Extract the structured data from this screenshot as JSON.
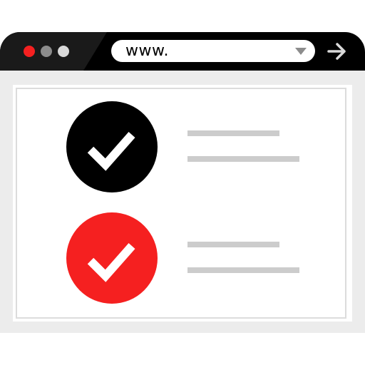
{
  "browser": {
    "url_text": "www.",
    "window_controls": [
      "close",
      "minimize",
      "maximize"
    ],
    "colors": {
      "close": "#f52020",
      "minimize": "#8c8c8c",
      "maximize": "#d9d9d9",
      "titlebar": "#000000"
    }
  },
  "checklist": {
    "items": [
      {
        "icon": "check-icon",
        "color": "#000000",
        "checked": true
      },
      {
        "icon": "check-icon",
        "color": "#f52020",
        "checked": true
      }
    ]
  }
}
